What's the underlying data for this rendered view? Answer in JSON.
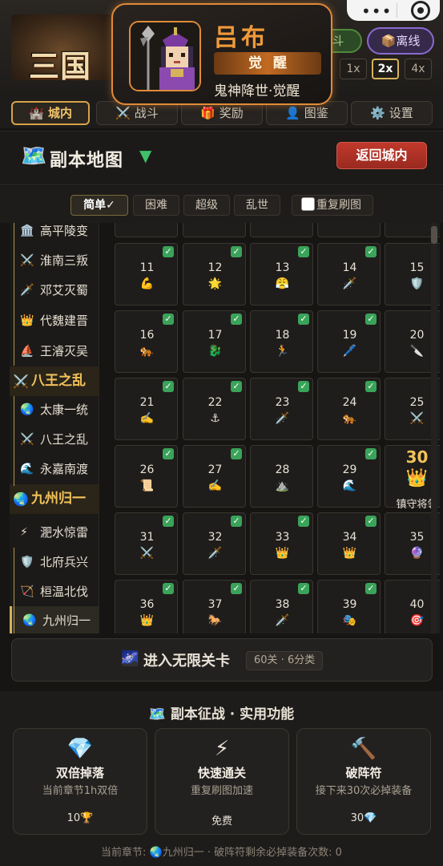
{
  "header": {
    "logo_text": "三国群",
    "hero_name": "吕布",
    "awaken_badge": "觉醒",
    "hero_subtitle": "鬼神降世·觉醒",
    "auto_battle_label": "自动战斗",
    "offline_label": "离线",
    "speed_options": [
      "1x",
      "2x",
      "4x"
    ],
    "speed_selected": "2x",
    "accent_color": "#e08a3a"
  },
  "nav_tabs": [
    {
      "icon": "🏰",
      "label": "城内",
      "active": true
    },
    {
      "icon": "⚔️",
      "label": "战斗",
      "active": false
    },
    {
      "icon": "🎁",
      "label": "奖励",
      "active": false
    },
    {
      "icon": "👤",
      "label": "图鉴",
      "active": false
    },
    {
      "icon": "⚙️",
      "label": "设置",
      "active": false
    }
  ],
  "map_header": {
    "icon": "🗺️",
    "title": "副本地图",
    "caret": "▼",
    "back_button": "返回城内"
  },
  "difficulty": {
    "options": [
      "简单✓",
      "困难",
      "超级",
      "乱世"
    ],
    "selected": "简单✓",
    "repeat_label": "重复刷图",
    "repeat_checked": false
  },
  "sidebar": [
    {
      "icon": "🏛️",
      "label": "高平陵变",
      "group": false
    },
    {
      "icon": "⚔️",
      "label": "淮南三叛",
      "group": false
    },
    {
      "icon": "🗡️",
      "label": "邓艾灭蜀",
      "group": false
    },
    {
      "icon": "👑",
      "label": "代魏建晋",
      "group": false
    },
    {
      "icon": "⛵",
      "label": "王濬灭吴",
      "group": false
    },
    {
      "icon": "⚔️",
      "label": "八王之乱",
      "group": true
    },
    {
      "icon": "🌏",
      "label": "太康一统",
      "group": false
    },
    {
      "icon": "⚔️",
      "label": "八王之乱",
      "group": false
    },
    {
      "icon": "🌊",
      "label": "永嘉南渡",
      "group": false
    },
    {
      "icon": "🌏",
      "label": "九州归一",
      "group": true
    },
    {
      "icon": "⚡",
      "label": "淝水惊雷",
      "group": false
    },
    {
      "icon": "🛡️",
      "label": "北府兵兴",
      "group": false
    },
    {
      "icon": "🏹",
      "label": "桓温北伐",
      "group": false
    },
    {
      "icon": "🌏",
      "label": "九州归一",
      "group": false,
      "selected": true
    }
  ],
  "stages": [
    {
      "n": "11",
      "icon": "💪",
      "done": true
    },
    {
      "n": "12",
      "icon": "🌟",
      "done": true
    },
    {
      "n": "13",
      "icon": "😤",
      "done": true
    },
    {
      "n": "14",
      "icon": "🗡️",
      "done": true
    },
    {
      "n": "15",
      "icon": "🛡️",
      "done": false
    },
    {
      "n": "16",
      "icon": "🐅",
      "done": true
    },
    {
      "n": "17",
      "icon": "🐉",
      "done": true
    },
    {
      "n": "18",
      "icon": "🏃",
      "done": true
    },
    {
      "n": "19",
      "icon": "🖊️",
      "done": true
    },
    {
      "n": "20",
      "icon": "🔪",
      "done": false
    },
    {
      "n": "21",
      "icon": "✍️",
      "done": true
    },
    {
      "n": "22",
      "icon": "⚓",
      "done": true
    },
    {
      "n": "23",
      "icon": "🗡️",
      "done": true
    },
    {
      "n": "24",
      "icon": "🐅",
      "done": true
    },
    {
      "n": "25",
      "icon": "⚔️",
      "done": false
    },
    {
      "n": "26",
      "icon": "📜",
      "done": true
    },
    {
      "n": "27",
      "icon": "✍️",
      "done": true
    },
    {
      "n": "28",
      "icon": "⛰️",
      "done": false
    },
    {
      "n": "29",
      "icon": "🌊",
      "done": true
    },
    {
      "n": "30",
      "icon": "👑",
      "done": false,
      "boss": true,
      "caption": "镇守将领"
    },
    {
      "n": "31",
      "icon": "⚔️",
      "done": true
    },
    {
      "n": "32",
      "icon": "🗡️",
      "done": true
    },
    {
      "n": "33",
      "icon": "👑",
      "done": true
    },
    {
      "n": "34",
      "icon": "👑",
      "done": true
    },
    {
      "n": "35",
      "icon": "🔮",
      "done": false
    },
    {
      "n": "36",
      "icon": "👑",
      "done": true
    },
    {
      "n": "37",
      "icon": "🐎",
      "done": true
    },
    {
      "n": "38",
      "icon": "🗡️",
      "done": true
    },
    {
      "n": "39",
      "icon": "🎭",
      "done": true
    },
    {
      "n": "40",
      "icon": "🎯",
      "done": false
    }
  ],
  "endless": {
    "icon": "🌌",
    "label": "进入无限关卡",
    "tag": "60关 · 6分类"
  },
  "features": {
    "title": "🗺️ 副本征战 · 实用功能",
    "cards": [
      {
        "icon": "💎",
        "name": "双倍掉落",
        "desc": "当前章节1h双倍",
        "cost": "10🏆"
      },
      {
        "icon": "⚡",
        "name": "快速通关",
        "desc": "重复刷图加速",
        "cost": "免费"
      },
      {
        "icon": "🔨",
        "name": "破阵符",
        "desc": "接下来30次必掉装备",
        "cost": "30💎"
      }
    ]
  },
  "footer": "当前章节: 🌏九州归一 · 破阵符剩余必掉装备次数: 0"
}
